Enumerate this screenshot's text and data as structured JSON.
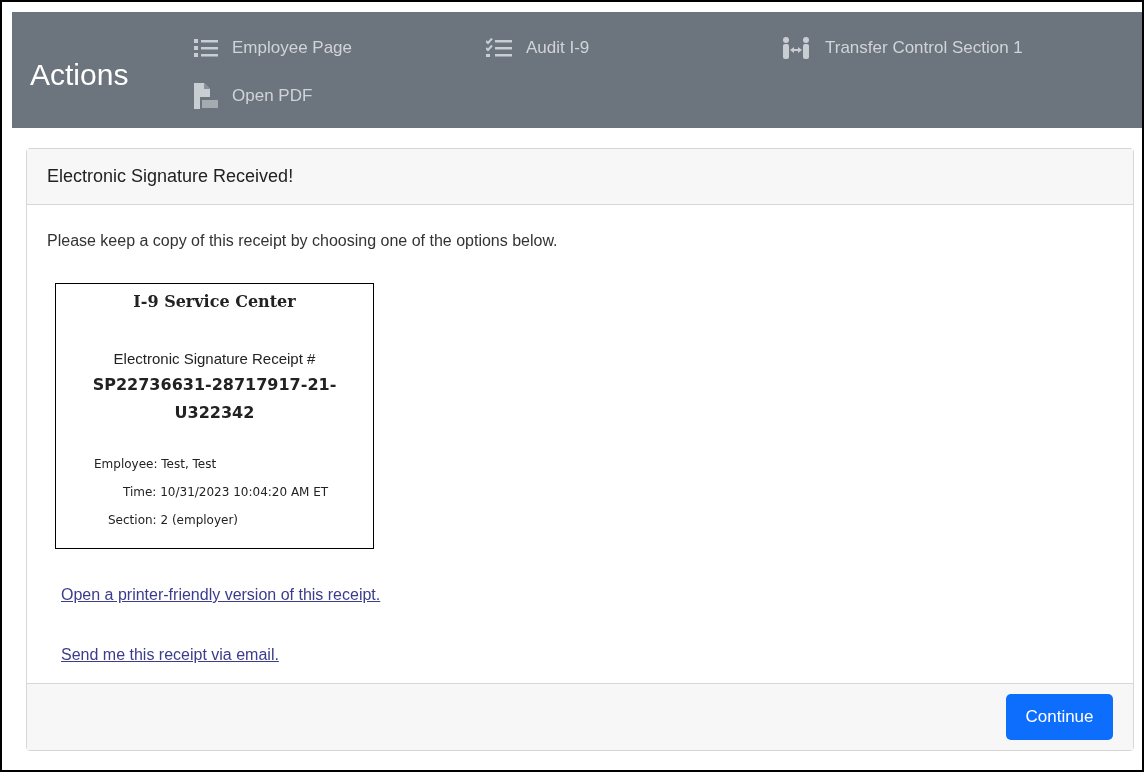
{
  "header": {
    "title": "Actions",
    "actions": [
      {
        "label": "Employee Page",
        "kind": "list"
      },
      {
        "label": "Audit I-9",
        "kind": "checklist"
      },
      {
        "label": "Transfer Control Section 1",
        "kind": "transfer"
      },
      {
        "label": "Open PDF",
        "kind": "pdf"
      }
    ]
  },
  "card": {
    "title": "Electronic Signature Received!",
    "instruction": "Please keep a copy of this receipt by choosing one of the options below.",
    "receipt": {
      "title": "I-9 Service Center",
      "label": "Electronic Signature Receipt #",
      "number_lines": [
        "SP22736631-28717917-21-",
        "U322342"
      ],
      "details": [
        "Employee: Test, Test",
        "Time: 10/31/2023 10:04:20 AM ET",
        "Section: 2 (employer)"
      ]
    },
    "links": [
      "Open a printer-friendly version of this receipt.",
      "Send me this receipt via email."
    ],
    "button": "Continue"
  }
}
